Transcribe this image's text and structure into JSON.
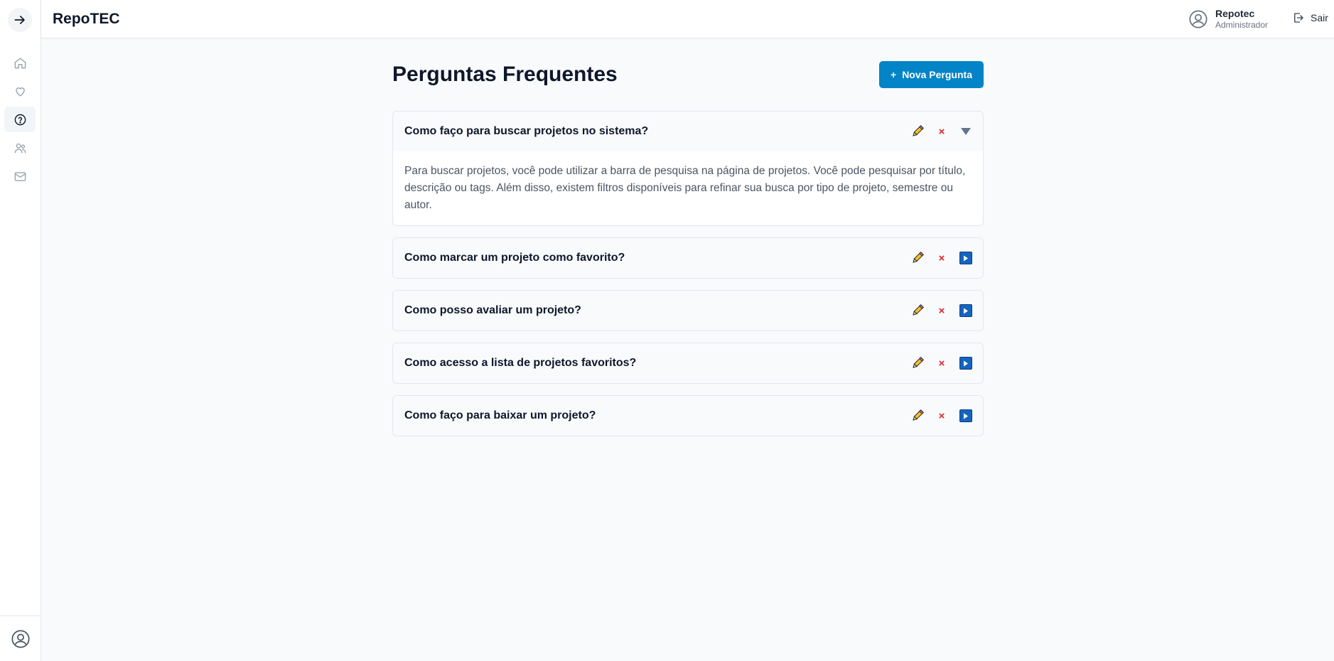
{
  "header": {
    "brand": "RepoTEC",
    "user_name": "Repotec",
    "user_role": "Administrador",
    "logout_label": "Sair"
  },
  "sidebar": {
    "items": [
      {
        "icon": "home-icon",
        "active": false
      },
      {
        "icon": "heart-icon",
        "active": false
      },
      {
        "icon": "help-circle-icon",
        "active": true
      },
      {
        "icon": "users-icon",
        "active": false
      },
      {
        "icon": "mail-icon",
        "active": false
      }
    ]
  },
  "main": {
    "title": "Perguntas Frequentes",
    "new_button_icon": "+",
    "new_button_label": "Nova Pergunta",
    "faqs": [
      {
        "question": "Como faço para buscar projetos no sistema?",
        "expanded": true,
        "answer": "Para buscar projetos, você pode utilizar a barra de pesquisa na página de projetos. Você pode pesquisar por título, descrição ou tags. Além disso, existem filtros disponíveis para refinar sua busca por tipo de projeto, semestre ou autor."
      },
      {
        "question": "Como marcar um projeto como favorito?",
        "expanded": false
      },
      {
        "question": "Como posso avaliar um projeto?",
        "expanded": false
      },
      {
        "question": "Como acesso a lista de projetos favoritos?",
        "expanded": false
      },
      {
        "question": "Como faço para baixar um projeto?",
        "expanded": false
      }
    ],
    "delete_glyph": "×"
  },
  "colors": {
    "accent": "#0284c7",
    "delete": "#dc2626",
    "expand": "#1565c0"
  }
}
